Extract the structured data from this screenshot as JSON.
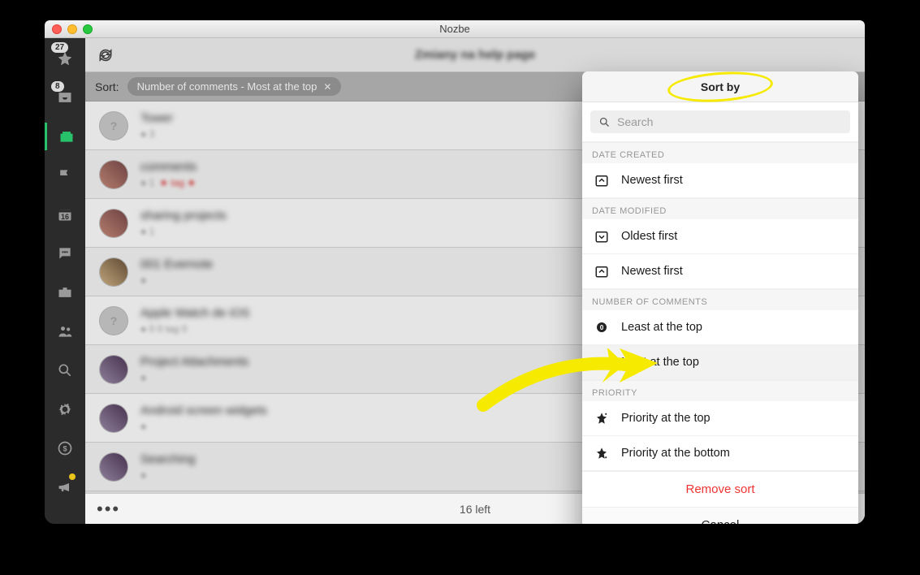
{
  "window": {
    "title": "Nozbe"
  },
  "header": {
    "page_title_blurred": "Zmiany na help page"
  },
  "sortbar": {
    "label": "Sort:",
    "chip": "Number of comments - Most at the top"
  },
  "sidebar": {
    "star_badge": "27",
    "inbox_badge": "8",
    "calendar_day": "16"
  },
  "tasks": [
    {
      "name": "Tower",
      "meta": "● 3",
      "avatar": "q"
    },
    {
      "name": "comments",
      "meta": "● 1",
      "meta_red": "★ tag ★",
      "avatar": "photo1"
    },
    {
      "name": "sharing projects",
      "meta": "● 1",
      "avatar": "photo1"
    },
    {
      "name": "001 Evernote",
      "meta": "●",
      "avatar": "photo2"
    },
    {
      "name": "Apple Watch de iOS",
      "meta": "● 0  0 tag 0",
      "avatar": "q"
    },
    {
      "name": "Project Attachments",
      "meta": "●",
      "avatar": "photo3"
    },
    {
      "name": "Android screen widgets",
      "meta": "●",
      "avatar": "photo3"
    },
    {
      "name": "Searching",
      "meta": "●",
      "avatar": "photo3"
    }
  ],
  "footer": {
    "count_text": "16 left"
  },
  "panel": {
    "title": "Sort by",
    "search_placeholder": "Search",
    "sections": {
      "date_created": {
        "label": "DATE CREATED",
        "options": [
          {
            "key": "dc_newest",
            "label": "Newest first"
          }
        ]
      },
      "date_modified": {
        "label": "DATE MODIFIED",
        "options": [
          {
            "key": "dm_oldest",
            "label": "Oldest first"
          },
          {
            "key": "dm_newest",
            "label": "Newest first"
          }
        ]
      },
      "comments": {
        "label": "NUMBER OF COMMENTS",
        "options": [
          {
            "key": "nc_least",
            "label": "Least at the top"
          },
          {
            "key": "nc_most",
            "label": "Most at the top",
            "highlight": true
          }
        ]
      },
      "priority": {
        "label": "PRIORITY",
        "options": [
          {
            "key": "pr_top",
            "label": "Priority at the top"
          },
          {
            "key": "pr_bot",
            "label": "Priority at the bottom"
          }
        ]
      }
    },
    "remove": "Remove sort",
    "cancel": "Cancel"
  }
}
